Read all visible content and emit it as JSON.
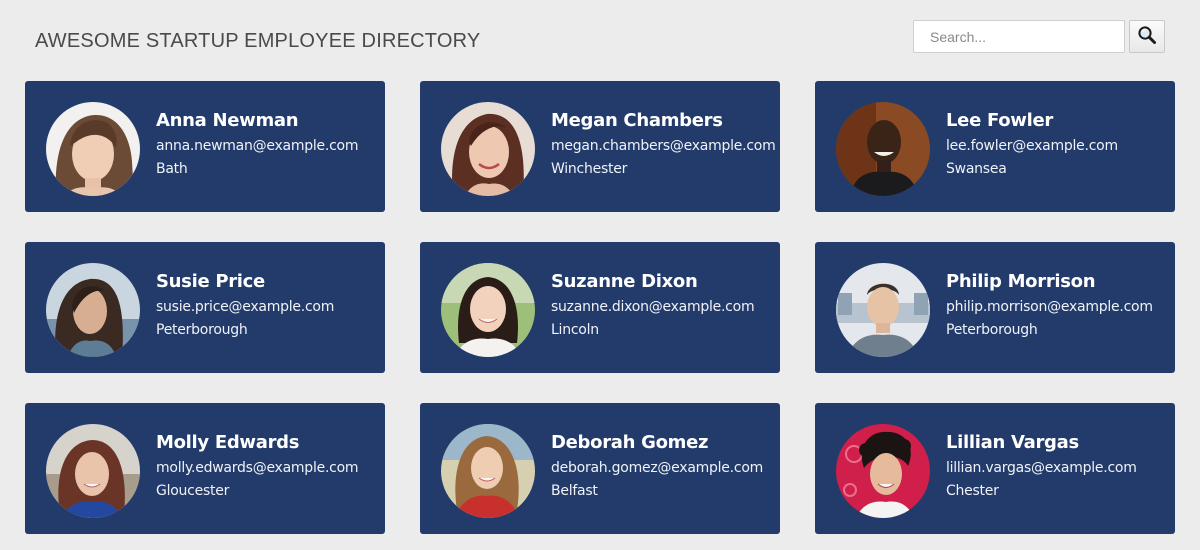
{
  "header": {
    "title": "AWESOME STARTUP EMPLOYEE DIRECTORY"
  },
  "search": {
    "placeholder": "Search...",
    "value": "",
    "button_icon": "search-icon"
  },
  "colors": {
    "background": "#ececec",
    "card": "#223b6b",
    "card_text": "#ffffff",
    "title_text": "#4a4a4a"
  },
  "employees": [
    {
      "name": "Anna Newman",
      "email": "anna.newman@example.com",
      "city": "Bath"
    },
    {
      "name": "Megan Chambers",
      "email": "megan.chambers@example.com",
      "city": "Winchester"
    },
    {
      "name": "Lee Fowler",
      "email": "lee.fowler@example.com",
      "city": "Swansea"
    },
    {
      "name": "Susie Price",
      "email": "susie.price@example.com",
      "city": "Peterborough"
    },
    {
      "name": "Suzanne Dixon",
      "email": "suzanne.dixon@example.com",
      "city": "Lincoln"
    },
    {
      "name": "Philip Morrison",
      "email": "philip.morrison@example.com",
      "city": "Peterborough"
    },
    {
      "name": "Molly Edwards",
      "email": "molly.edwards@example.com",
      "city": "Gloucester"
    },
    {
      "name": "Deborah Gomez",
      "email": "deborah.gomez@example.com",
      "city": "Belfast"
    },
    {
      "name": "Lillian Vargas",
      "email": "lillian.vargas@example.com",
      "city": "Chester"
    }
  ]
}
